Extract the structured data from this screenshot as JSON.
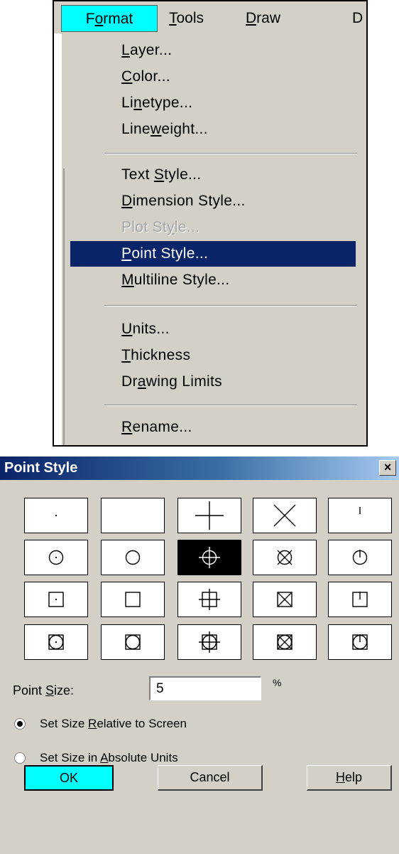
{
  "menubar": {
    "format": "Format",
    "tools": "Tools",
    "draw": "Draw",
    "next": "D"
  },
  "menu": {
    "groups": [
      [
        "Layer...",
        "Color...",
        "Linetype...",
        "Lineweight..."
      ],
      [
        "Text Style...",
        "Dimension Style...",
        "Plot Style...",
        "Point Style...",
        "Multiline Style..."
      ],
      [
        "Units...",
        "Thickness",
        "Drawing Limits"
      ],
      [
        "Rename..."
      ]
    ],
    "disabled_item": "Plot Style...",
    "selected_item": "Point Style..."
  },
  "dialog": {
    "title": "Point Style",
    "close_label": "×",
    "point_styles": {
      "rows": 4,
      "columns": 5,
      "selected": "row 2, column 3"
    },
    "point_size_label": "Point Size:",
    "point_size_value": "5",
    "percent_symbol": "%",
    "radio_relative": "Set Size Relative to Screen",
    "radio_absolute": "Set Size in Absolute Units",
    "selected_radio": "Set Size Relative to Screen",
    "ok_label": "OK",
    "cancel_label": "Cancel",
    "help_label": "Help"
  },
  "colors": {
    "menu_highlight": "#0a246a",
    "active_menu": "#00ffff",
    "face": "#d4d0c8"
  }
}
